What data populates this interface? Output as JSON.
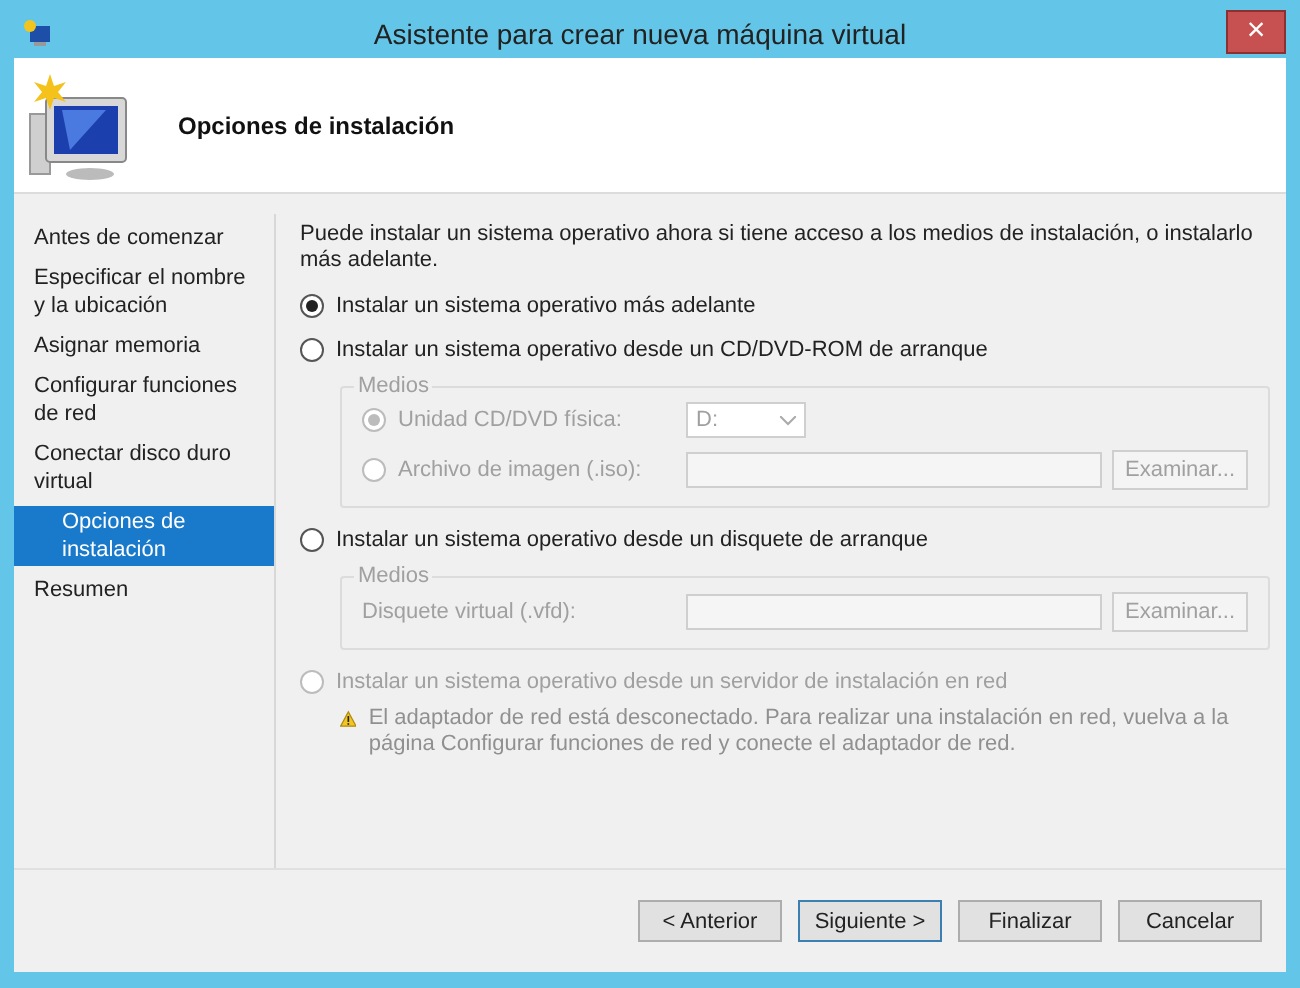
{
  "window": {
    "title": "Asistente para crear nueva máquina virtual",
    "close": "×"
  },
  "header": {
    "title": "Opciones de instalación"
  },
  "nav": [
    {
      "label": "Antes de comenzar",
      "selected": false
    },
    {
      "label": "Especificar el nombre y la ubicación",
      "selected": false
    },
    {
      "label": "Asignar memoria",
      "selected": false
    },
    {
      "label": "Configurar funciones de red",
      "selected": false
    },
    {
      "label": "Conectar disco duro virtual",
      "selected": false
    },
    {
      "label": "Opciones de instalación",
      "selected": true
    },
    {
      "label": "Resumen",
      "selected": false
    }
  ],
  "description": "Puede instalar un sistema operativo ahora si tiene acceso a los medios de instalación, o instalarlo más adelante.",
  "options": [
    {
      "label": "Instalar un sistema operativo más adelante",
      "selected": true,
      "disabled": false
    },
    {
      "label": "Instalar un sistema operativo desde un CD/DVD-ROM de arranque",
      "selected": false,
      "disabled": false,
      "media": {
        "legend": "Medios",
        "disabled": true,
        "rows": [
          {
            "kind": "radio",
            "label": "Unidad CD/DVD física:",
            "selected": true,
            "control": {
              "kind": "select",
              "value": "D:"
            }
          },
          {
            "kind": "radio",
            "label": "Archivo de imagen (.iso):",
            "selected": false,
            "control": {
              "kind": "file",
              "button": "Examinar..."
            }
          }
        ]
      }
    },
    {
      "label": "Instalar un sistema operativo desde un disquete de arranque",
      "selected": false,
      "disabled": false,
      "media": {
        "legend": "Medios",
        "disabled": true,
        "rows": [
          {
            "kind": "label",
            "label": "Disquete virtual (.vfd):",
            "control": {
              "kind": "file",
              "button": "Examinar..."
            }
          }
        ]
      }
    },
    {
      "label": "Instalar un sistema operativo desde un servidor de instalación en red",
      "selected": false,
      "disabled": true,
      "warning": "El adaptador de red está desconectado. Para realizar una instalación en red, vuelva a la página Configurar funciones de red y conecte el adaptador de red."
    }
  ],
  "buttons": [
    {
      "label": "< Anterior",
      "focused": false
    },
    {
      "label": "Siguiente >",
      "focused": true
    },
    {
      "label": "Finalizar",
      "focused": false
    },
    {
      "label": "Cancelar",
      "focused": false
    }
  ]
}
